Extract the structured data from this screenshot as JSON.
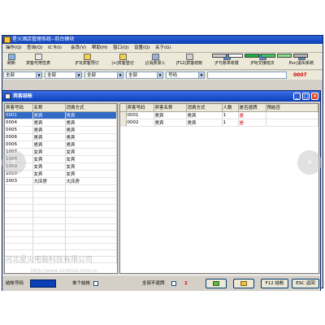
{
  "app": {
    "title": "星火酒店管理系统--前台模块"
  },
  "menu": [
    "操作(Q)",
    "查询(Q)",
    "IC卡(I)",
    "会员(V)",
    "帮助(H)",
    "窗口(Q)",
    "设置(Q)",
    "关于(G)"
  ],
  "toolbar": {
    "buttons": [
      {
        "label": "刷新",
        "icon": "refresh-icon"
      },
      {
        "label": "宾客可用性表",
        "icon": "table-icon"
      },
      {
        "label": "|F3|宾客预订",
        "icon": "reserve-icon"
      },
      {
        "label": "|+|宾客登记",
        "icon": "register-icon"
      },
      {
        "label": "|/|消费录入",
        "icon": "consume-icon"
      },
      {
        "label": "|F12|宾客结帐",
        "icon": "checkout-icon"
      },
      {
        "label": "|F7|账单收银",
        "icon": "bill-icon"
      },
      {
        "label": "|F8|交接班次",
        "icon": "shift-icon"
      },
      {
        "label": "Esc|退出系统",
        "icon": "exit-icon"
      }
    ],
    "swatches": [
      "#cfcfcf",
      "#ffffff",
      "#18b43c",
      "#3cc864",
      "#8ce08c",
      "#b4b4b4"
    ]
  },
  "filters": [
    {
      "value": "全部"
    },
    {
      "value": "全部"
    },
    {
      "value": "全部"
    },
    {
      "value": "全部"
    },
    {
      "value": "号码"
    }
  ],
  "counter": "0007",
  "child": {
    "title": "宾客结帐"
  },
  "left_table": {
    "headers": [
      "宾客号码",
      "名称",
      "消费方式"
    ],
    "rows": [
      [
        "0001",
        "男宾",
        "男宾"
      ],
      [
        "0004",
        "男宾",
        "男宾"
      ],
      [
        "0005",
        "男宾",
        "男宾"
      ],
      [
        "0006",
        "男宾",
        "男宾"
      ],
      [
        "0006",
        "男宾",
        "男宾"
      ],
      [
        "1007",
        "女宾",
        "女宾"
      ],
      [
        "1008",
        "女宾",
        "女宾"
      ],
      [
        "1009",
        "女宾",
        "女宾"
      ],
      [
        "1010",
        "女宾",
        "女宾"
      ],
      [
        "2003",
        "大床房",
        "大床房"
      ]
    ]
  },
  "right_table": {
    "headers": [
      "宾客号码",
      "宾客名称",
      "消费方式",
      "人数",
      "是否退牌",
      "预结否"
    ],
    "rows": [
      [
        "0001",
        "男宾",
        "男宾",
        "1",
        "是",
        ""
      ],
      [
        "0002",
        "男宾",
        "男宾",
        "1",
        "是",
        ""
      ]
    ]
  },
  "status": {
    "checkout_no_label": "结帐号码",
    "single_checkout_label": "单个结帐",
    "all_no_return_label": "全部不退牌",
    "count": "2",
    "f12_label": "F12 结帐",
    "esc_label": "ESC 返回"
  },
  "watermark": {
    "company": "河北星火电脑科技有限公司",
    "url": "http://www.xinghuo.com.cn"
  }
}
